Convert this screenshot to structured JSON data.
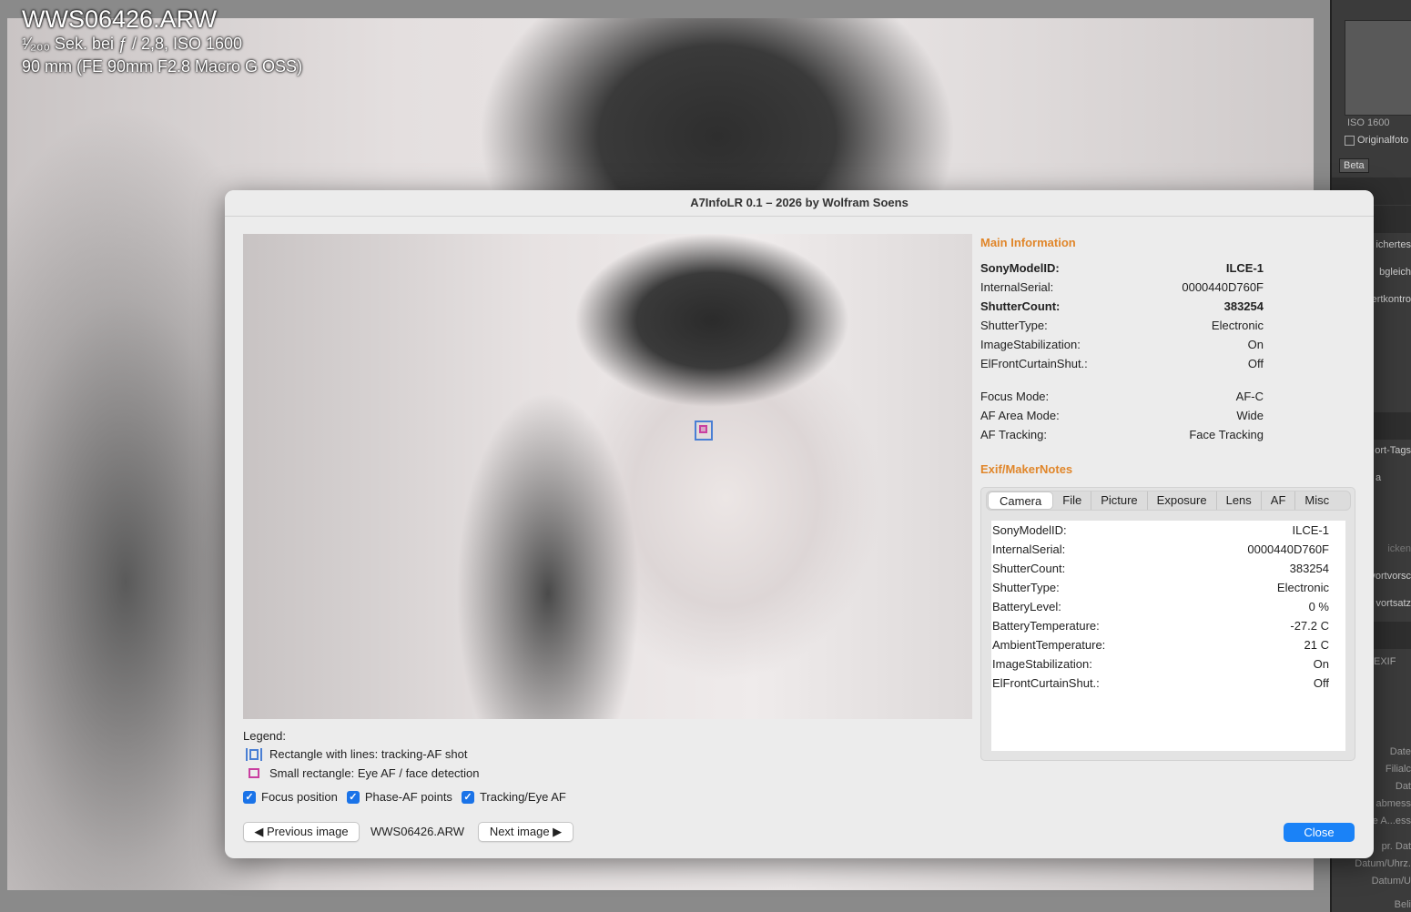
{
  "background": {
    "filename": "WWS06426.ARW",
    "exposure": "¹⁄₂₀₀ Sek. bei ƒ / 2,8, ISO 1600",
    "lens": "90 mm (FE 90mm F2.8 Macro G OSS)"
  },
  "lr_panel": {
    "iso": "ISO 1600",
    "original_photo": "Originalfoto",
    "beta": "Beta",
    "rows": [
      "ichertes",
      "bgleich",
      "ertkontro",
      "ort-Tags",
      "a",
      "icken",
      "vortvorsc",
      "vortsatz",
      "EXIF",
      "Date",
      "Filialc",
      "Dat",
      "abmess",
      "e A...ess",
      "pr. Dat",
      "Datum/Uhrz.",
      "Datum/U",
      "Beli"
    ]
  },
  "dialog": {
    "title": "A7InfoLR 0.1 – 2026 by Wolfram Soens",
    "legend": {
      "title": "Legend:",
      "tracking": "Rectangle with lines: tracking-AF shot",
      "eye": "Small rectangle: Eye AF / face detection"
    },
    "checkboxes": [
      {
        "label": "Focus position",
        "checked": true
      },
      {
        "label": "Phase-AF points",
        "checked": true
      },
      {
        "label": "Tracking/Eye AF",
        "checked": true
      }
    ],
    "prev_button": "◀ Previous image",
    "next_button": "Next image ▶",
    "current_file": "WWS06426.ARW",
    "close_button": "Close",
    "main_info": {
      "title": "Main Information",
      "rows": [
        {
          "key": "SonyModelID:",
          "value": "ILCE-1",
          "bold": true
        },
        {
          "key": "InternalSerial:",
          "value": "0000440D760F",
          "bold": false
        },
        {
          "key": "ShutterCount:",
          "value": "383254",
          "bold": true
        },
        {
          "key": "ShutterType:",
          "value": "Electronic",
          "bold": false
        },
        {
          "key": "ImageStabilization:",
          "value": "On",
          "bold": false
        },
        {
          "key": "ElFrontCurtainShut.:",
          "value": "Off",
          "bold": false
        }
      ],
      "focus_rows": [
        {
          "key": "Focus Mode:",
          "value": "AF-C"
        },
        {
          "key": "AF Area Mode:",
          "value": "Wide"
        },
        {
          "key": "AF Tracking:",
          "value": "Face Tracking"
        }
      ]
    },
    "exif": {
      "title": "Exif/MakerNotes",
      "tabs": [
        "Camera",
        "File",
        "Picture",
        "Exposure",
        "Lens",
        "AF",
        "Misc"
      ],
      "active_tab": "Camera",
      "rows": [
        {
          "key": "SonyModelID:",
          "value": "ILCE-1"
        },
        {
          "key": "InternalSerial:",
          "value": "0000440D760F"
        },
        {
          "key": "ShutterCount:",
          "value": "383254"
        },
        {
          "key": "ShutterType:",
          "value": "Electronic"
        },
        {
          "key": "BatteryLevel:",
          "value": "0 %"
        },
        {
          "key": "BatteryTemperature:",
          "value": "-27.2 C"
        },
        {
          "key": "AmbientTemperature:",
          "value": "21 C"
        },
        {
          "key": "ImageStabilization:",
          "value": "On"
        },
        {
          "key": "ElFrontCurtainShut.:",
          "value": "Off"
        }
      ]
    }
  },
  "colors": {
    "accent_orange": "#e0862a",
    "button_blue": "#1a82f7",
    "tracking_rect": "#4a7fd4",
    "eye_rect": "#c93fa0"
  }
}
